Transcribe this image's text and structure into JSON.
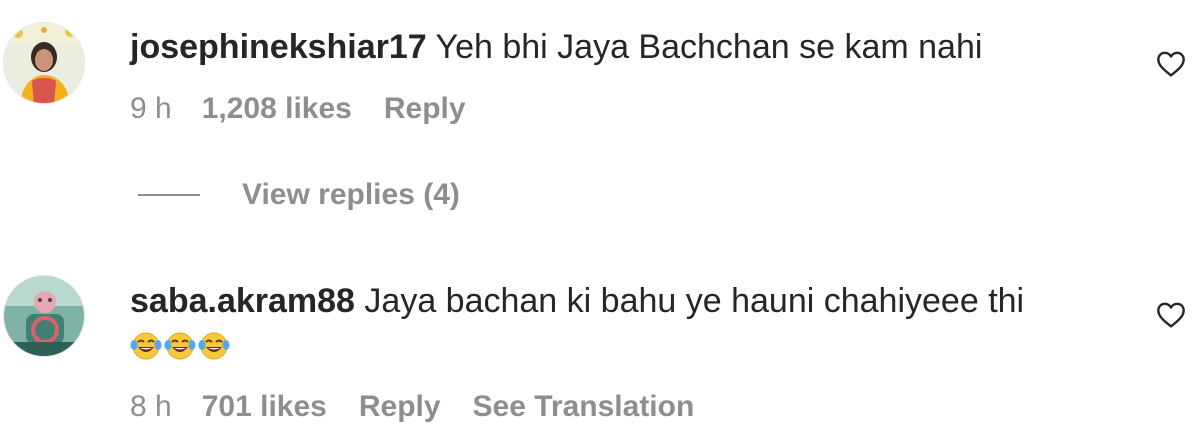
{
  "comments": [
    {
      "username": "josephinekshiar17",
      "text": "Yeh bhi Jaya Bachchan se kam nahi",
      "time": "9 h",
      "likes": "1,208 likes",
      "reply_label": "Reply",
      "view_replies": "View replies (4)",
      "avatar": "profile-photo"
    },
    {
      "username": "saba.akram88",
      "text": "Jaya bachan ki bahu ye hauni chahiyeee thi",
      "emojis": [
        "face-with-tears-of-joy",
        "face-with-tears-of-joy",
        "face-with-tears-of-joy"
      ],
      "time": "8 h",
      "likes": "701 likes",
      "reply_label": "Reply",
      "translate_label": "See Translation",
      "avatar": "profile-photo"
    }
  ],
  "icons": {
    "like": "heart-outline-icon"
  },
  "colors": {
    "text_primary": "#262626",
    "text_secondary": "#8e8e8e",
    "background": "#ffffff"
  }
}
